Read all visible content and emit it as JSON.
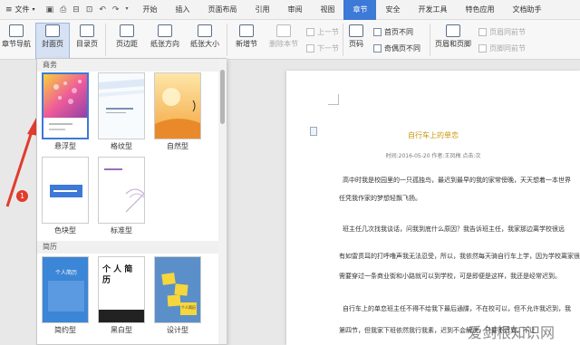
{
  "menubar": {
    "file_label": "文件",
    "tabs": [
      "开始",
      "插入",
      "页面布局",
      "引用",
      "审阅",
      "视图",
      "章节",
      "安全",
      "开发工具",
      "特色应用",
      "文档助手"
    ],
    "active_tab": "章节",
    "accent": "#3d79d7"
  },
  "ribbon": {
    "nav_label": "章节导航",
    "cover_label": "封面页",
    "toc_label": "目录页",
    "margin_label": "页边距",
    "orientation_label": "纸张方向",
    "size_label": "纸张大小",
    "add_section_label": "新增节",
    "delete_section_label": "删除本节",
    "prev_section_label": "上一节",
    "next_section_label": "下一节",
    "page_number_label": "页码",
    "first_page_diff_label": "首页不同",
    "odd_even_diff_label": "奇偶页不同",
    "header_footer_label": "页眉和页脚",
    "same_as_prev_header_label": "页眉同前节",
    "same_as_prev_footer_label": "页脚同前节"
  },
  "cover_panel": {
    "section_business": "商务",
    "section_resume": "简历",
    "templates_row1": [
      "悬浮型",
      "格纹型",
      "自然型"
    ],
    "templates_row2": [
      "色块型",
      "标准型"
    ],
    "templates_row3": [
      "简约型",
      "黑白型",
      "设计型"
    ],
    "resume_text_1": "个人简历",
    "resume_text_2": "个 人 简 历",
    "resume_text_3": "个人简历"
  },
  "annotation": {
    "badge": "1",
    "color": "#e13c2e"
  },
  "document": {
    "title": "自行车上的单恋",
    "meta": "时间:2016-05-20  作者:王凤梅  点击:次",
    "paragraphs": [
      "高中时我是校园里的一只孤独鸟，最迟到最早的我的家常傍晚，天天想着一本世界",
      "任凭我作家的梦想轻飘飞扬。",
      "班主任几次找我谈话，问我到底什么原因？我告诉班主任，我家那边离学校很远",
      "有如雷贯耳的打呼噜声我无法忍受，所以，我依然每天骑自行车上学，因为学校离家很近",
      "需要穿过一条商业街和小路就可以到学校，可是即便是这样，我还是经常迟到。",
      "自行车上的单恋班主任不得不给我下最后通牒，不在校可以，但不允许我迟到，我",
      "第四节，但我家下班依然我行我素，迟到不会解决，只要不迟到，不让"
    ]
  },
  "watermark": "爱剑根知识网"
}
